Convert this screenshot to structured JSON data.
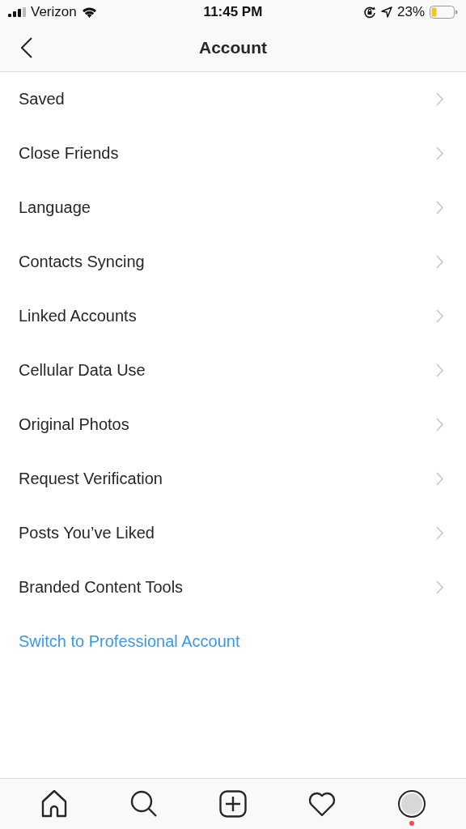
{
  "status_bar": {
    "carrier": "Verizon",
    "time": "11:45 PM",
    "battery": "23%"
  },
  "header": {
    "title": "Account"
  },
  "items": [
    {
      "label": "Saved"
    },
    {
      "label": "Close Friends"
    },
    {
      "label": "Language"
    },
    {
      "label": "Contacts Syncing"
    },
    {
      "label": "Linked Accounts"
    },
    {
      "label": "Cellular Data Use"
    },
    {
      "label": "Original Photos"
    },
    {
      "label": "Request Verification"
    },
    {
      "label": "Posts You’ve Liked"
    },
    {
      "label": "Branded Content Tools"
    }
  ],
  "link": "Switch to Professional Account",
  "tab_bar": [
    {
      "kind": "home",
      "selected": false,
      "notification": false
    },
    {
      "kind": "search",
      "selected": false,
      "notification": false
    },
    {
      "kind": "add",
      "selected": false,
      "notification": false
    },
    {
      "kind": "activity",
      "selected": false,
      "notification": false
    },
    {
      "kind": "profile",
      "selected": true,
      "notification": true
    }
  ]
}
